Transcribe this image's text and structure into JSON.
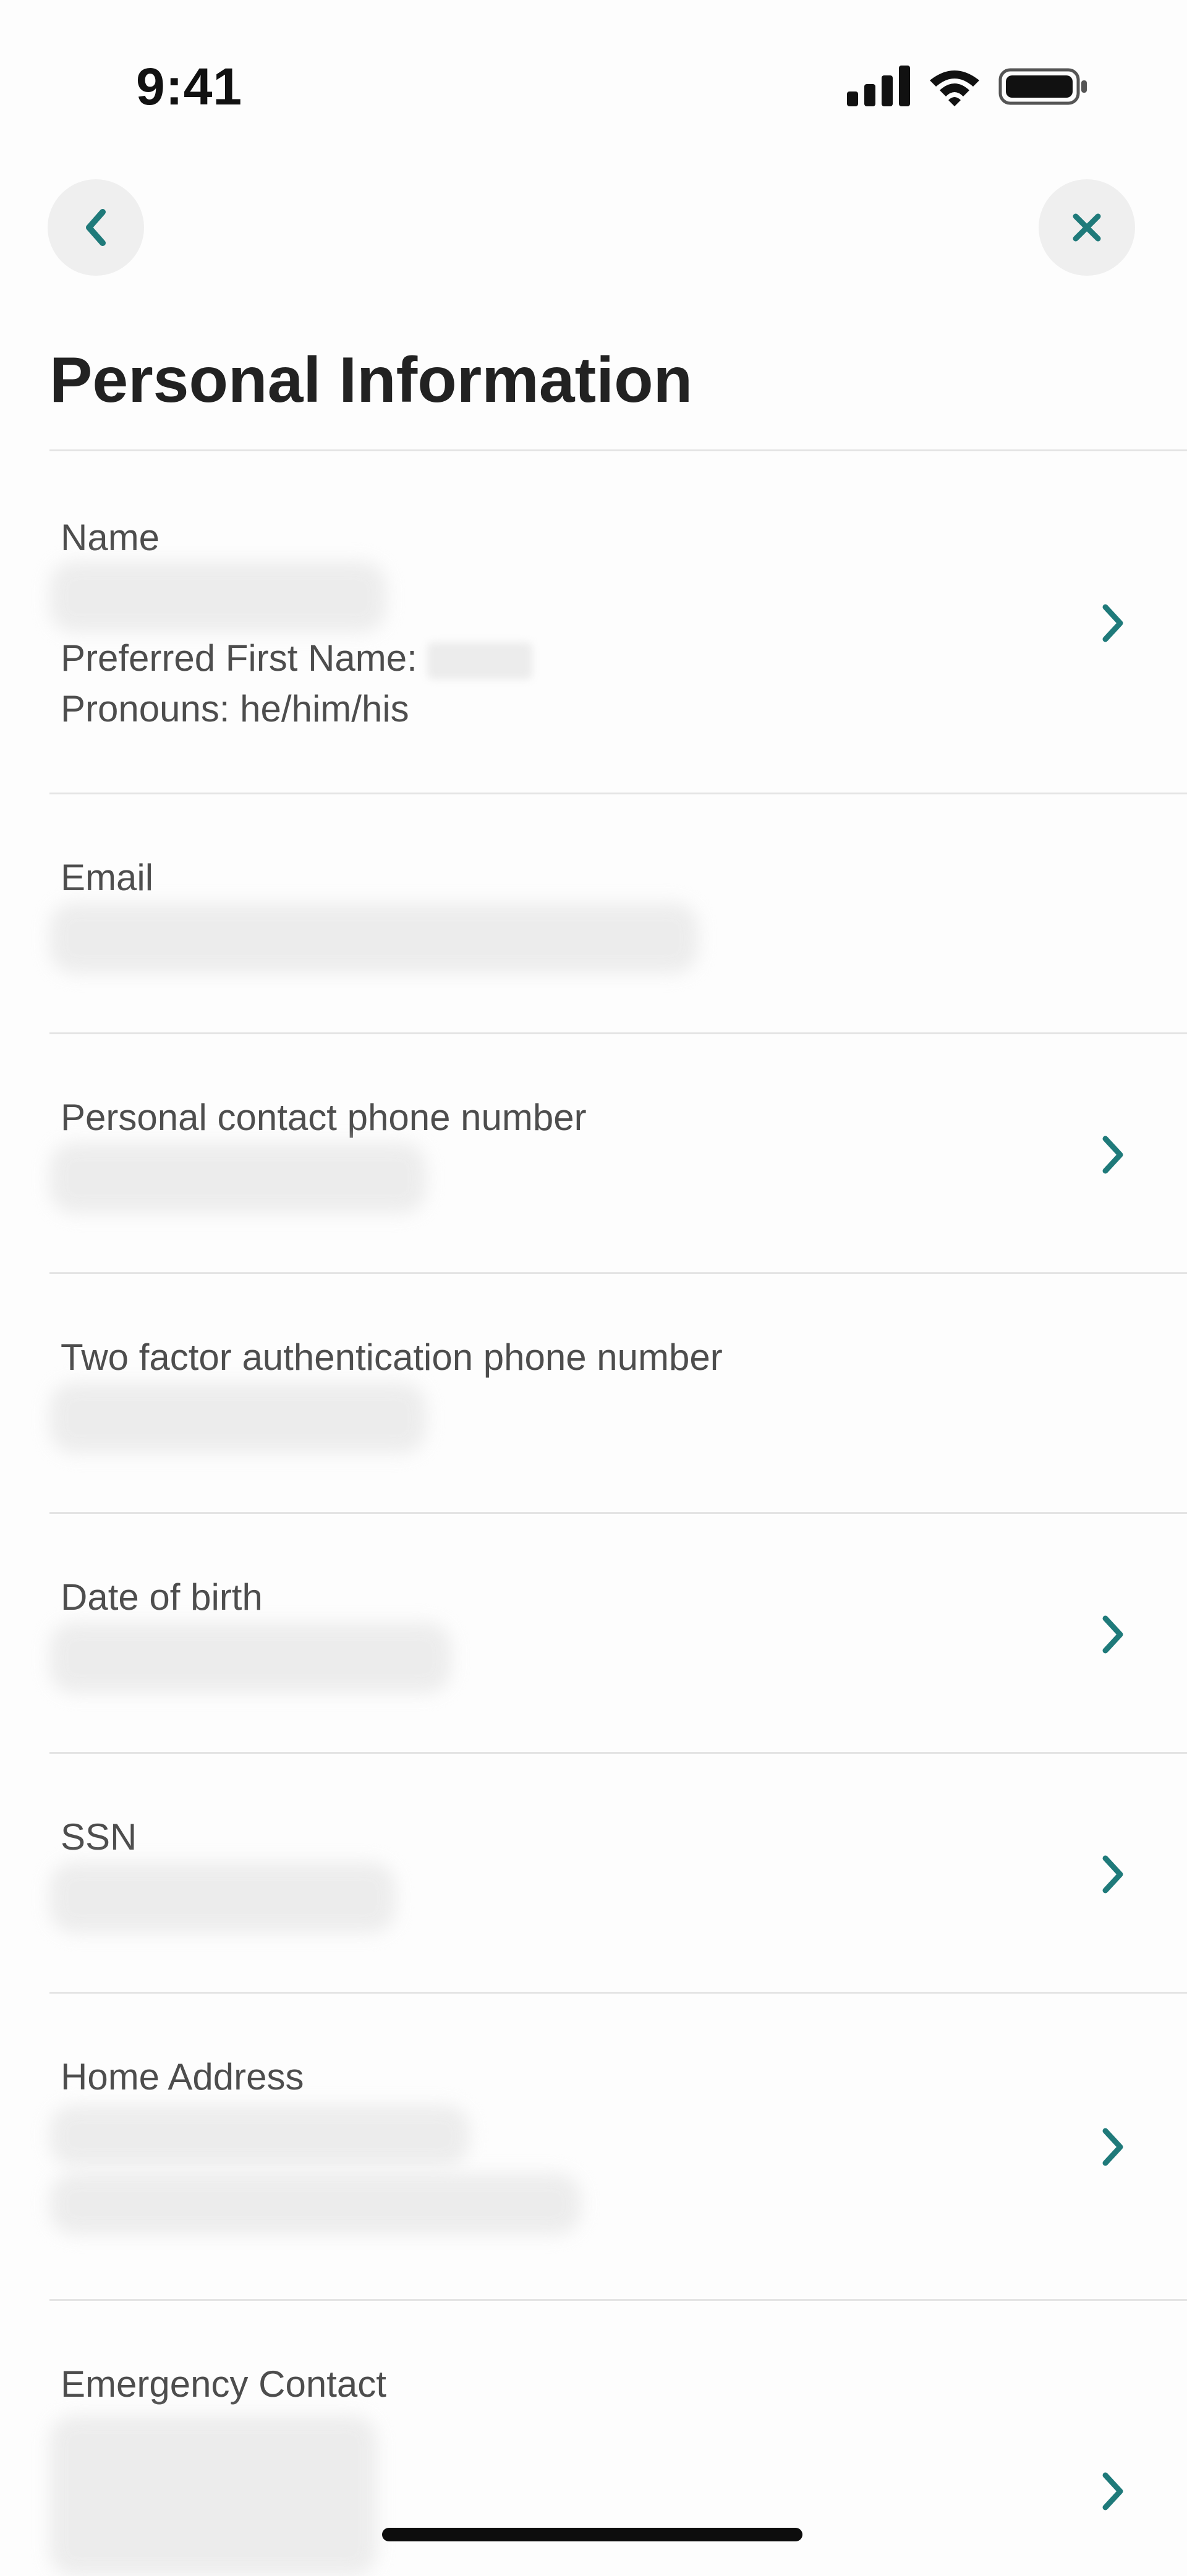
{
  "status_bar": {
    "time": "9:41",
    "icons": [
      "signal-icon",
      "wifi-icon",
      "battery-icon"
    ]
  },
  "nav": {
    "back_icon": "chevron-left-icon",
    "close_icon": "close-icon",
    "accent_color": "#1f7a7a",
    "button_bg": "#efefef"
  },
  "page": {
    "title": "Personal Information"
  },
  "rows": [
    {
      "label": "Name",
      "preferred_first_name_label": "Preferred First Name:",
      "pronouns": "Pronouns: he/him/his",
      "has_chevron": true
    },
    {
      "label": "Email",
      "has_chevron": false
    },
    {
      "label": "Personal contact phone number",
      "has_chevron": true
    },
    {
      "label": "Two factor authentication phone number",
      "has_chevron": false
    },
    {
      "label": "Date of birth",
      "has_chevron": true
    },
    {
      "label": "SSN",
      "has_chevron": true
    },
    {
      "label": "Home Address",
      "has_chevron": true
    },
    {
      "label": "Emergency Contact",
      "has_chevron": true
    }
  ]
}
